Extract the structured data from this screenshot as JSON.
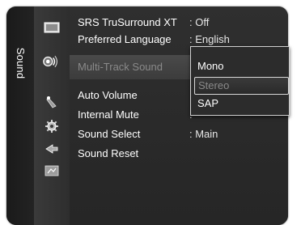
{
  "side_tab": {
    "label": "Sound"
  },
  "icons": [
    {
      "name": "picture-icon"
    },
    {
      "name": "sound-icon"
    },
    {
      "name": "channel-icon"
    },
    {
      "name": "setup-icon"
    },
    {
      "name": "input-icon"
    },
    {
      "name": "application-icon"
    }
  ],
  "menu": {
    "items": [
      {
        "label": "SRS TruSurround XT",
        "value": ": Off"
      },
      {
        "label": "Preferred Language",
        "value": ": English"
      },
      {
        "label": "Multi-Track Sound",
        "value": ":"
      },
      {
        "label": "Auto Volume",
        "value": ":"
      },
      {
        "label": "Internal Mute",
        "value": ":"
      },
      {
        "label": "Sound Select",
        "value": ": Main"
      },
      {
        "label": "Sound Reset",
        "value": ""
      }
    ]
  },
  "popup": {
    "options": [
      "Mono",
      "Stereo",
      "SAP"
    ],
    "selected": "Stereo"
  }
}
